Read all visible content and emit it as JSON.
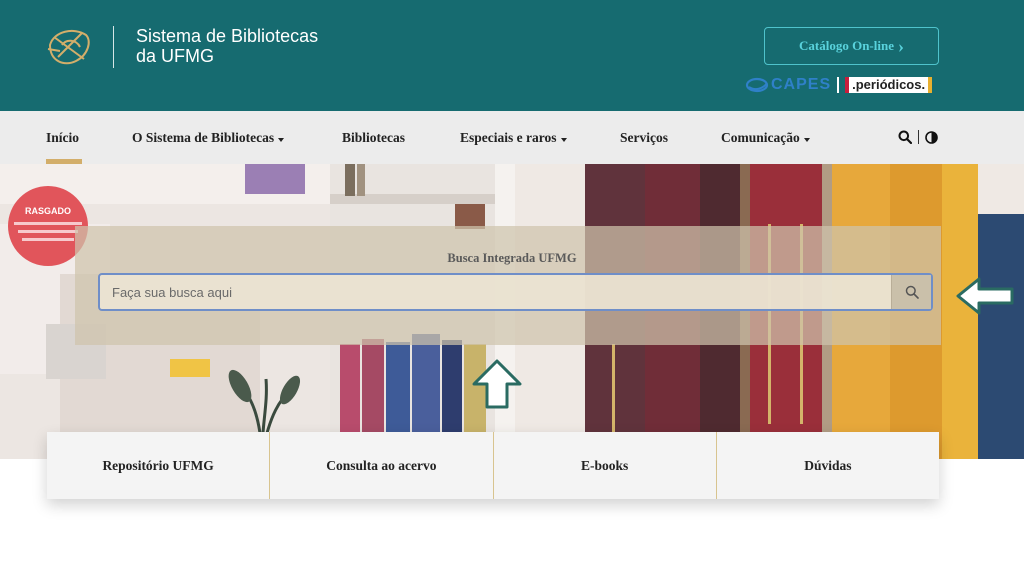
{
  "header": {
    "title_line1": "Sistema de Bibliotecas",
    "title_line2": "da UFMG",
    "catalog_button": "Catálogo On-line",
    "catalog_chevron": "›",
    "capes_text": "CAPES",
    "periodicos_text": ".periódicos.",
    "colors": {
      "background": "#166b70",
      "accent": "#59d2dc",
      "logo": "#d3ae6a"
    }
  },
  "nav": {
    "items": [
      {
        "label": "Início",
        "active": true,
        "dropdown": false
      },
      {
        "label": "O Sistema de Bibliotecas",
        "active": false,
        "dropdown": true
      },
      {
        "label": "Bibliotecas",
        "active": false,
        "dropdown": false
      },
      {
        "label": "Especiais e raros",
        "active": false,
        "dropdown": true
      },
      {
        "label": "Serviços",
        "active": false,
        "dropdown": false
      },
      {
        "label": "Comunicação",
        "active": false,
        "dropdown": true
      }
    ],
    "tools": {
      "search_icon": "search-icon",
      "contrast_icon": "contrast-icon"
    }
  },
  "hero": {
    "poster_text": "RASGADO",
    "search": {
      "title": "Busca Integrada UFMG",
      "placeholder": "Faça sua busca aqui",
      "button_icon": "search-icon"
    }
  },
  "cards": [
    {
      "label": "Repositório UFMG"
    },
    {
      "label": "Consulta ao acervo"
    },
    {
      "label": "E-books"
    },
    {
      "label": "Dúvidas"
    }
  ]
}
